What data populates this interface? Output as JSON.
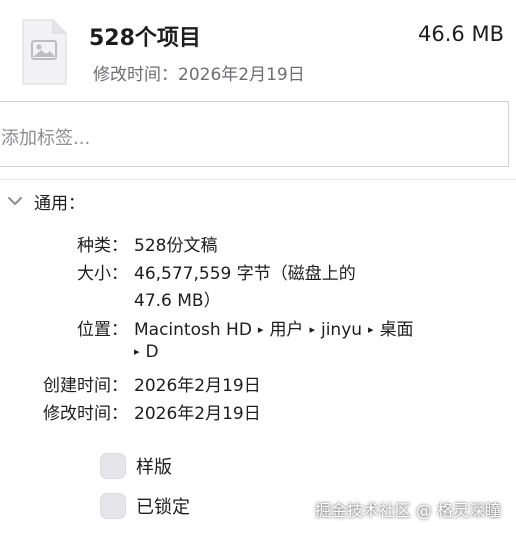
{
  "header": {
    "title": "528个项目",
    "size": "46.6 MB",
    "modified": "修改时间：2026年2月19日",
    "icon": "document-image-icon"
  },
  "tags": {
    "placeholder": "添加标签..."
  },
  "general": {
    "title": "通用：",
    "kind_label": "种类：",
    "kind_value": "528份文稿",
    "size_label": "大小：",
    "size_value_line1": "46,577,559 字节（磁盘上的",
    "size_value_line2": "47.6 MB）",
    "location_label": "位置：",
    "location_parts": [
      "Macintosh HD",
      "用户",
      "jinyu",
      "桌面",
      "D"
    ],
    "created_label": "创建时间：",
    "created_value": "2026年2月19日",
    "modified_label": "修改时间：",
    "modified_value": "2026年2月19日"
  },
  "options": {
    "stationery_label": "样版",
    "locked_label": "已锁定"
  },
  "watermark": "掘金技术社区 @ 格灵深瞳",
  "colors": {
    "text": "#1d1d1f",
    "secondary": "#6e6e73",
    "placeholder": "#8e8e93",
    "border": "#d2d2d7",
    "checkbox_fill": "#e5e5ea"
  }
}
